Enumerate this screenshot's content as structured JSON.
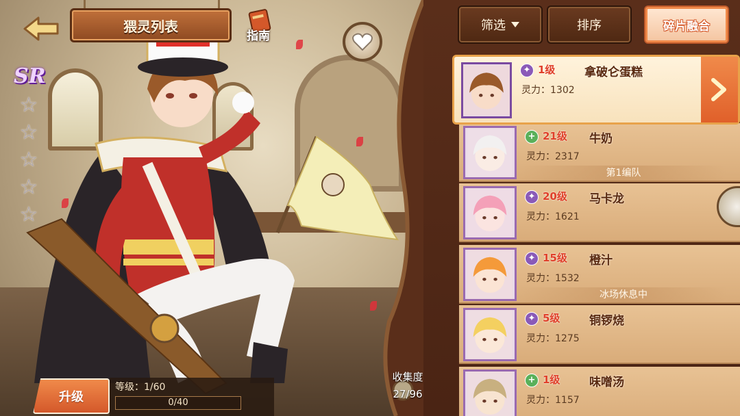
{
  "header": {
    "title": "猥灵列表",
    "guide_label": "指南"
  },
  "rarity": "SR",
  "stars": [
    "☆",
    "☆",
    "☆",
    "☆",
    "☆"
  ],
  "bottom": {
    "upgrade_label": "升级",
    "level_text": "等级：1/60",
    "xp_text": "0/40",
    "xp_progress": 0
  },
  "collection": {
    "label": "收集度",
    "value": "27/96"
  },
  "toolbar": {
    "filter_label": "筛选",
    "sort_label": "排序",
    "fusion_label": "碎片融合"
  },
  "cards": [
    {
      "level": "1级",
      "name": "拿破仑蛋糕",
      "spirit": "灵力：1302",
      "element": "purple",
      "tag": "",
      "selected": true,
      "hair": "#9a5a2a",
      "skin": "#f8dcc8"
    },
    {
      "level": "21级",
      "name": "牛奶",
      "spirit": "灵力：2317",
      "element": "green",
      "tag": "第1编队",
      "selected": false,
      "hair": "#f2f0f0",
      "skin": "#faece4"
    },
    {
      "level": "20级",
      "name": "马卡龙",
      "spirit": "灵力：1621",
      "element": "purple",
      "tag": "",
      "selected": false,
      "hair": "#f4a0b8",
      "skin": "#fbe4e0"
    },
    {
      "level": "15级",
      "name": "橙汁",
      "spirit": "灵力：1532",
      "element": "purple",
      "tag": "冰场休息中",
      "selected": false,
      "hair": "#f49a3a",
      "skin": "#fbe4d4"
    },
    {
      "level": "5级",
      "name": "铜锣烧",
      "spirit": "灵力：1275",
      "element": "purple",
      "tag": "",
      "selected": false,
      "hair": "#f4d060",
      "skin": "#fbe8d8"
    },
    {
      "level": "1级",
      "name": "味噌汤",
      "spirit": "灵力：1157",
      "element": "green",
      "tag": "",
      "selected": false,
      "hair": "#c8b080",
      "skin": "#f8e4d0"
    }
  ],
  "colors": {
    "accent": "#e0602a",
    "panel": "#5a2e1a",
    "card": "#e8c294",
    "level_red": "#e0402a"
  }
}
